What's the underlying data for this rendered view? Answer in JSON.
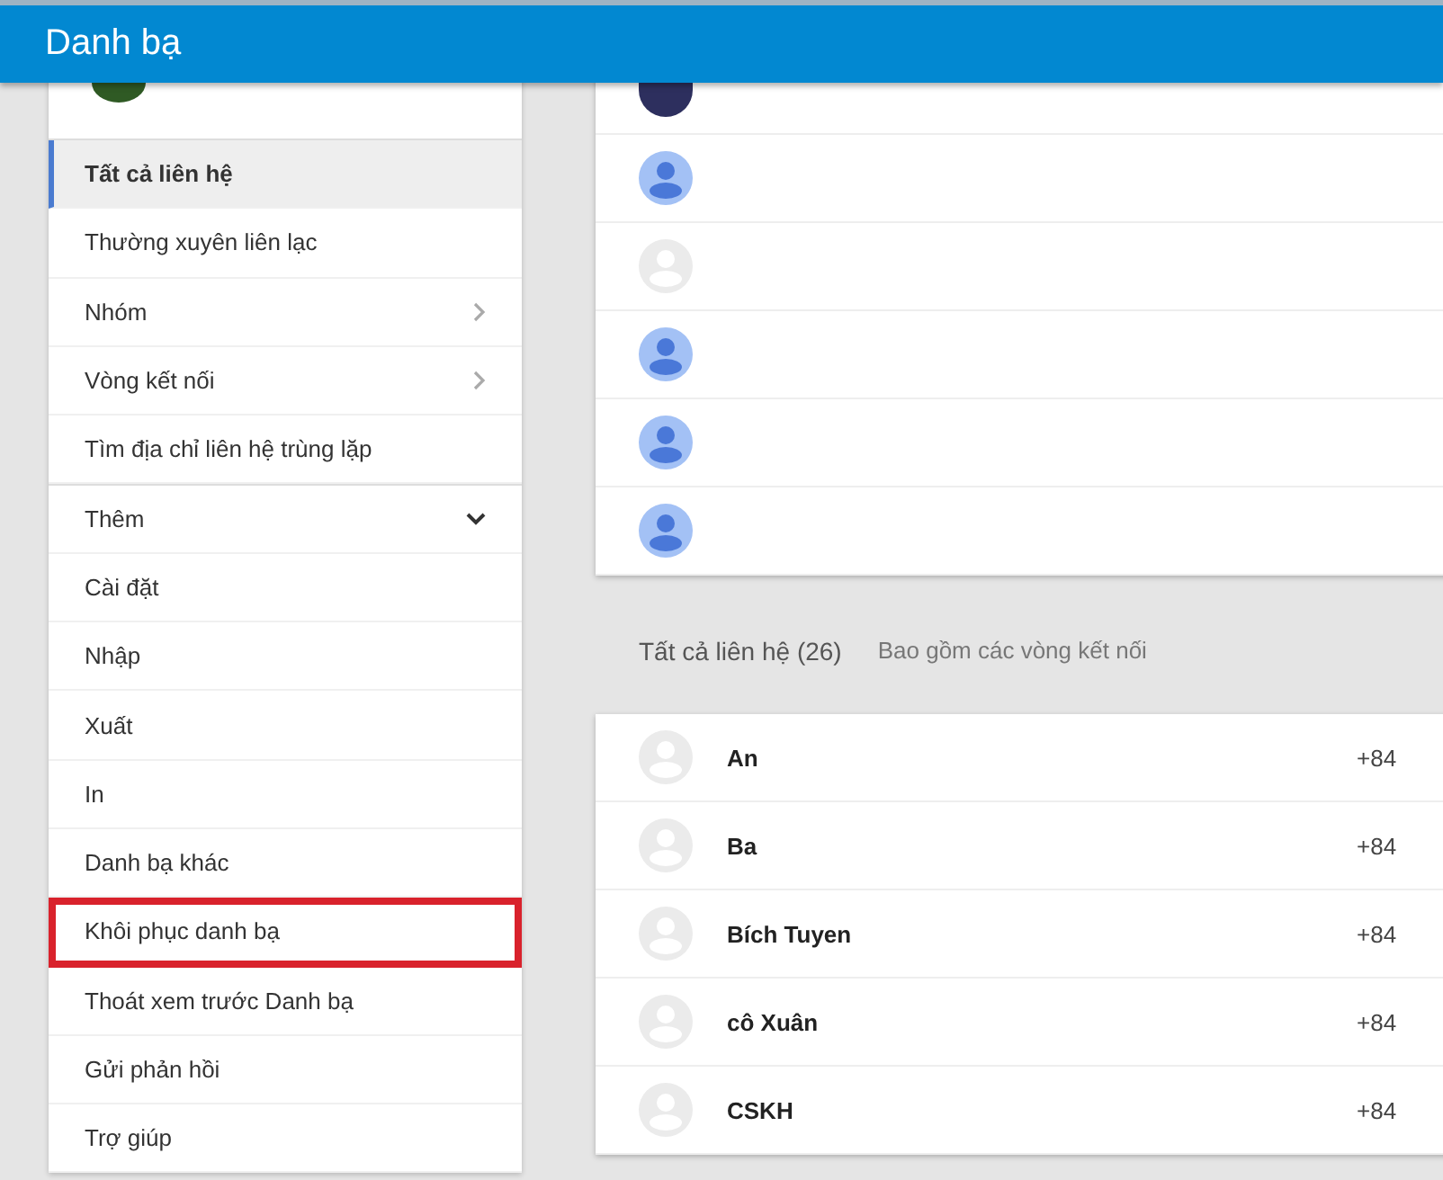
{
  "header": {
    "title": "Danh bạ"
  },
  "sidebar": {
    "items": [
      {
        "label": "Tất cả liên hệ",
        "selected": true,
        "kind": "plain"
      },
      {
        "label": "Thường xuyên liên lạc",
        "selected": false,
        "kind": "plain"
      },
      {
        "label": "Nhóm",
        "selected": false,
        "kind": "submenu"
      },
      {
        "label": "Vòng kết nối",
        "selected": false,
        "kind": "submenu"
      },
      {
        "label": "Tìm địa chỉ liên hệ trùng lặp",
        "selected": false,
        "kind": "plain"
      },
      {
        "label": "Thêm",
        "selected": false,
        "kind": "expandable",
        "expanded": true
      },
      {
        "label": "Cài đặt",
        "selected": false,
        "kind": "plain"
      },
      {
        "label": "Nhập",
        "selected": false,
        "kind": "plain"
      },
      {
        "label": "Xuất",
        "selected": false,
        "kind": "plain"
      },
      {
        "label": "In",
        "selected": false,
        "kind": "plain"
      },
      {
        "label": "Danh bạ khác",
        "selected": false,
        "kind": "plain"
      },
      {
        "label": "Khôi phục danh bạ",
        "selected": false,
        "kind": "plain",
        "highlighted": true
      },
      {
        "label": "Thoát xem trước Danh bạ",
        "selected": false,
        "kind": "plain"
      },
      {
        "label": "Gửi phản hồi",
        "selected": false,
        "kind": "plain"
      },
      {
        "label": "Trợ giúp",
        "selected": false,
        "kind": "plain"
      }
    ]
  },
  "frequent": {
    "rows": [
      {
        "kind": "photo"
      },
      {
        "kind": "blue"
      },
      {
        "kind": "grey"
      },
      {
        "kind": "blue"
      },
      {
        "kind": "blue"
      },
      {
        "kind": "blue"
      }
    ]
  },
  "contacts": {
    "title": "Tất cả liên hệ (26)",
    "subtitle": "Bao gồm các vòng kết nối",
    "rows": [
      {
        "name": "An",
        "phone": "+84"
      },
      {
        "name": "Ba",
        "phone": "+84"
      },
      {
        "name": "Bích Tuyen",
        "phone": "+84"
      },
      {
        "name": "cô Xuân",
        "phone": "+84"
      },
      {
        "name": "CSKH",
        "phone": "+84"
      }
    ]
  }
}
